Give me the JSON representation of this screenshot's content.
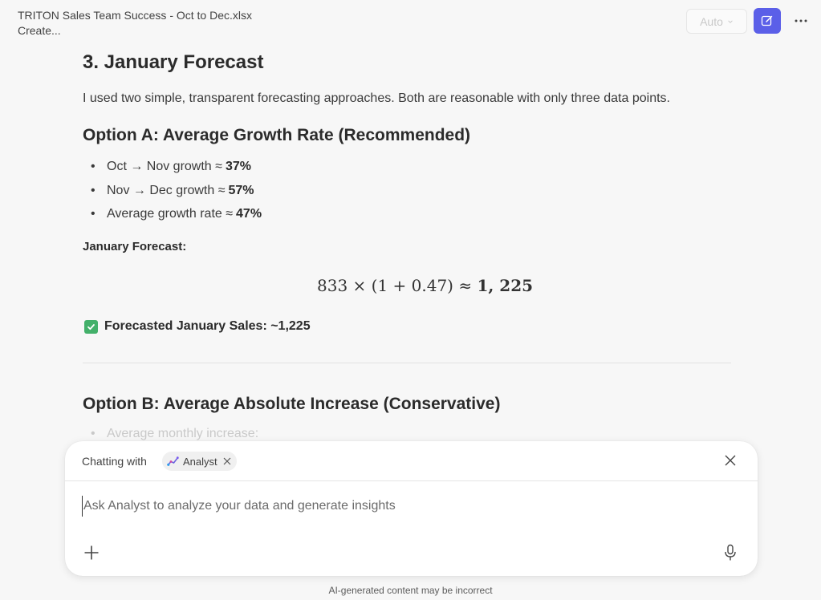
{
  "header": {
    "file_title": "TRITON Sales Team Success - Oct to Dec.xlsx",
    "file_subtitle": "Create...",
    "mode_label": "Auto",
    "edit_icon": "edit-icon",
    "more_icon": "more-icon"
  },
  "content": {
    "section_title": "3. January Forecast",
    "intro": "I used two simple, transparent forecasting approaches. Both are reasonable with only three data points.",
    "option_a": {
      "title": "Option A: Average Growth Rate (Recommended)",
      "bullets": [
        {
          "label": "Oct → Nov growth ≈",
          "value": "37%"
        },
        {
          "label": "Nov → Dec growth ≈",
          "value": "57%"
        },
        {
          "label": "Average growth rate ≈",
          "value": "47%"
        }
      ],
      "forecast_label": "January Forecast:",
      "formula": "833 × (1 + 0.47) ≈ ",
      "formula_result": "1, 225",
      "result_text": "Forecasted January Sales: ~1,225"
    },
    "option_b": {
      "title": "Option B: Average Absolute Increase (Conservative)",
      "first_bullet": "Average monthly increase:"
    }
  },
  "chat": {
    "chatting_with_label": "Chatting with",
    "agent_name": "Analyst",
    "input_placeholder": "Ask Analyst to analyze your data and generate insights",
    "input_value": ""
  },
  "footer": {
    "disclaimer": "AI-generated content may be incorrect"
  },
  "colors": {
    "accent": "#5b5fe8",
    "success": "#43b06a",
    "background": "#f7f7f7"
  }
}
